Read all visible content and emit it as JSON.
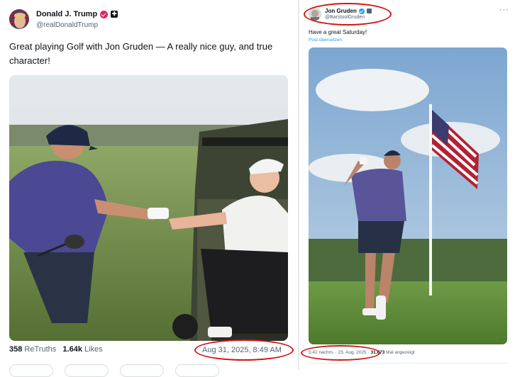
{
  "left_post": {
    "author_name": "Donald J. Trump",
    "handle": "@realDonaldTrump",
    "text": "Great playing Golf with Jon Gruden — A really nice guy, and true character!",
    "retruths_count": "358",
    "retruths_label": "ReTruths",
    "likes_count": "1.64k",
    "likes_label": "Likes",
    "timestamp": "Aug 31, 2025, 8:49 AM",
    "verified_badge_color": "#e0245e"
  },
  "right_post": {
    "author_name": "Jon Gruden",
    "handle": "@BarstoolGruden",
    "text": "Have a great Saturday!",
    "translate_link": "Post übersetzen",
    "timestamp": "5:42 nachm. · 23. Aug. 2025",
    "separator": "·",
    "views_count": "31.673",
    "views_label": "Mal angezeigt",
    "more_icon": "more-horizontal-icon",
    "verified_badge_color": "#1d9bf0"
  },
  "highlight_color": "#d21414"
}
